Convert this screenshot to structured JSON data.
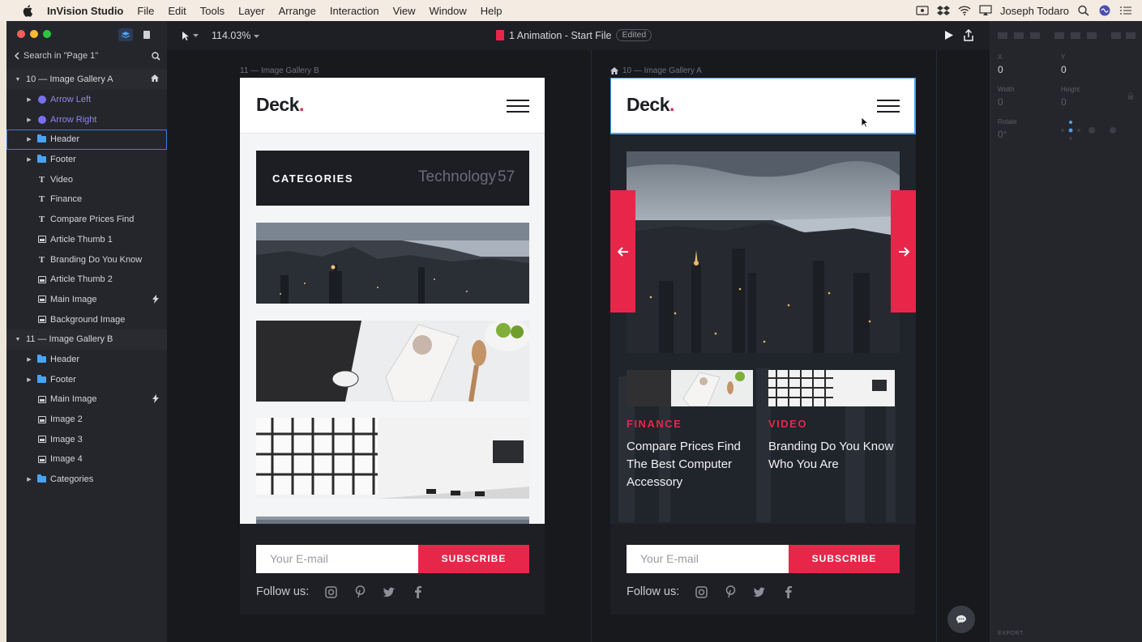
{
  "menubar": {
    "app_name": "InVision Studio",
    "items": [
      "File",
      "Edit",
      "Tools",
      "Layer",
      "Arrange",
      "Interaction",
      "View",
      "Window",
      "Help"
    ],
    "user": "Joseph Todaro"
  },
  "sidebar": {
    "search_label": "Search in \"Page 1\"",
    "layers": [
      {
        "label": "10 — Image Gallery A",
        "kind": "artboard",
        "expanded": true,
        "badge": "home-icon"
      },
      {
        "label": "Arrow Left",
        "kind": "symbol"
      },
      {
        "label": "Arrow Right",
        "kind": "symbol"
      },
      {
        "label": "Header",
        "kind": "folder",
        "selected": true
      },
      {
        "label": "Footer",
        "kind": "folder"
      },
      {
        "label": "Video",
        "kind": "text"
      },
      {
        "label": "Finance",
        "kind": "text"
      },
      {
        "label": "Compare Prices Find",
        "kind": "text"
      },
      {
        "label": "Article Thumb 1",
        "kind": "image"
      },
      {
        "label": "Branding Do You Know",
        "kind": "text"
      },
      {
        "label": "Article Thumb 2",
        "kind": "image"
      },
      {
        "label": "Main Image",
        "kind": "image",
        "badge": "lightning-icon"
      },
      {
        "label": "Background Image",
        "kind": "image"
      },
      {
        "label": "11 — Image Gallery B",
        "kind": "artboard",
        "expanded": true
      },
      {
        "label": "Header",
        "kind": "folder"
      },
      {
        "label": "Footer",
        "kind": "folder"
      },
      {
        "label": "Main Image",
        "kind": "image",
        "badge": "lightning-icon"
      },
      {
        "label": "Image 2",
        "kind": "image"
      },
      {
        "label": "Image 3",
        "kind": "image"
      },
      {
        "label": "Image 4",
        "kind": "image"
      },
      {
        "label": "Categories",
        "kind": "folder"
      }
    ]
  },
  "toolbar": {
    "zoom": "114.03%",
    "file_title": "1 Animation - Start File",
    "status": "Edited"
  },
  "artboard_b": {
    "label": "11 — Image Gallery B",
    "logo": "Deck",
    "logo_dot": ".",
    "categories_label": "CATEGORIES",
    "category_name": "Technology",
    "category_count": "57"
  },
  "artboard_a": {
    "label": "10 — Image Gallery A",
    "logo": "Deck",
    "logo_dot": ".",
    "card1_tag": "FINANCE",
    "card1_title": "Compare Prices Find The Best Computer Accessory",
    "card2_tag": "VIDEO",
    "card2_title": "Branding Do You Know Who You Are"
  },
  "footer": {
    "email_placeholder": "Your E-mail",
    "subscribe": "SUBSCRIBE",
    "follow": "Follow us:"
  },
  "props": {
    "x_label": "X",
    "x_value": "0",
    "y_label": "Y",
    "y_value": "0",
    "width_label": "Width",
    "width_value": "0",
    "height_label": "Height",
    "height_value": "0",
    "rotate_label": "Rotate",
    "rotate_value": "0°",
    "export_label": "EXPORT"
  },
  "colors": {
    "accent": "#e8264a",
    "selection": "#3b7be0",
    "symbol": "#8e86e8"
  }
}
